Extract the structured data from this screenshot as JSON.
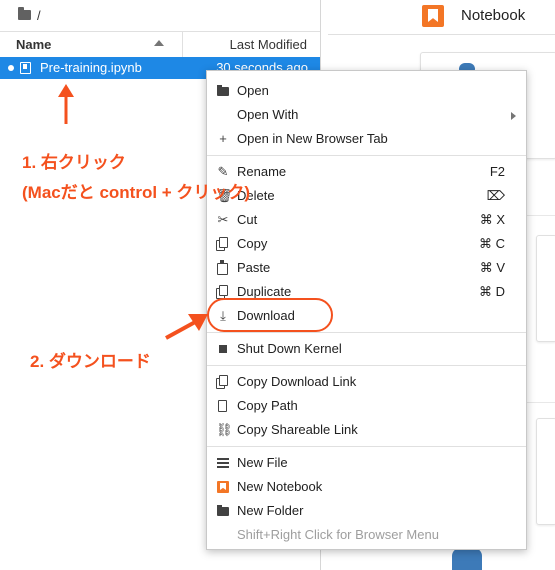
{
  "browser": {
    "breadcrumb": "/",
    "header": {
      "name": "Name",
      "modified": "Last Modified"
    },
    "file": {
      "name": "Pre-training.ipynb",
      "modified": "30 seconds ago"
    }
  },
  "launcher": {
    "tab_label": "Notebook"
  },
  "menu": {
    "items": [
      {
        "label": "Open",
        "icon": "folder-icon"
      },
      {
        "label": "Open With",
        "icon": "",
        "submenu": true
      },
      {
        "label": "Open in New Browser Tab",
        "icon": "plus-icon"
      },
      {
        "label": "Rename",
        "icon": "pencil-icon",
        "shortcut": "F2"
      },
      {
        "label": "Delete",
        "icon": "trash-icon",
        "shortcut": "⌦"
      },
      {
        "label": "Cut",
        "icon": "scissors-icon",
        "shortcut": "⌘ X"
      },
      {
        "label": "Copy",
        "icon": "copy-icon",
        "shortcut": "⌘ C"
      },
      {
        "label": "Paste",
        "icon": "clipboard-icon",
        "shortcut": "⌘ V"
      },
      {
        "label": "Duplicate",
        "icon": "duplicate-icon",
        "shortcut": "⌘ D"
      },
      {
        "label": "Download",
        "icon": "download-icon"
      },
      {
        "label": "Shut Down Kernel",
        "icon": "stop-icon"
      },
      {
        "label": "Copy Download Link",
        "icon": "copy-icon"
      },
      {
        "label": "Copy Path",
        "icon": "file-icon"
      },
      {
        "label": "Copy Shareable Link",
        "icon": "link-icon"
      },
      {
        "label": "New File",
        "icon": "text-file-icon"
      },
      {
        "label": "New Notebook",
        "icon": "notebook-icon"
      },
      {
        "label": "New Folder",
        "icon": "new-folder-icon"
      },
      {
        "label": "Shift+Right Click for Browser Menu",
        "icon": "",
        "disabled": true
      }
    ]
  },
  "annotations": {
    "step1_line1": "1. 右クリック",
    "step1_line2": "(Macだと control + クリック)",
    "step2": "2. ダウンロード",
    "accent_color": "#f4511e"
  },
  "colors": {
    "selection": "#1e88e5",
    "notebook_orange": "#f37626"
  }
}
